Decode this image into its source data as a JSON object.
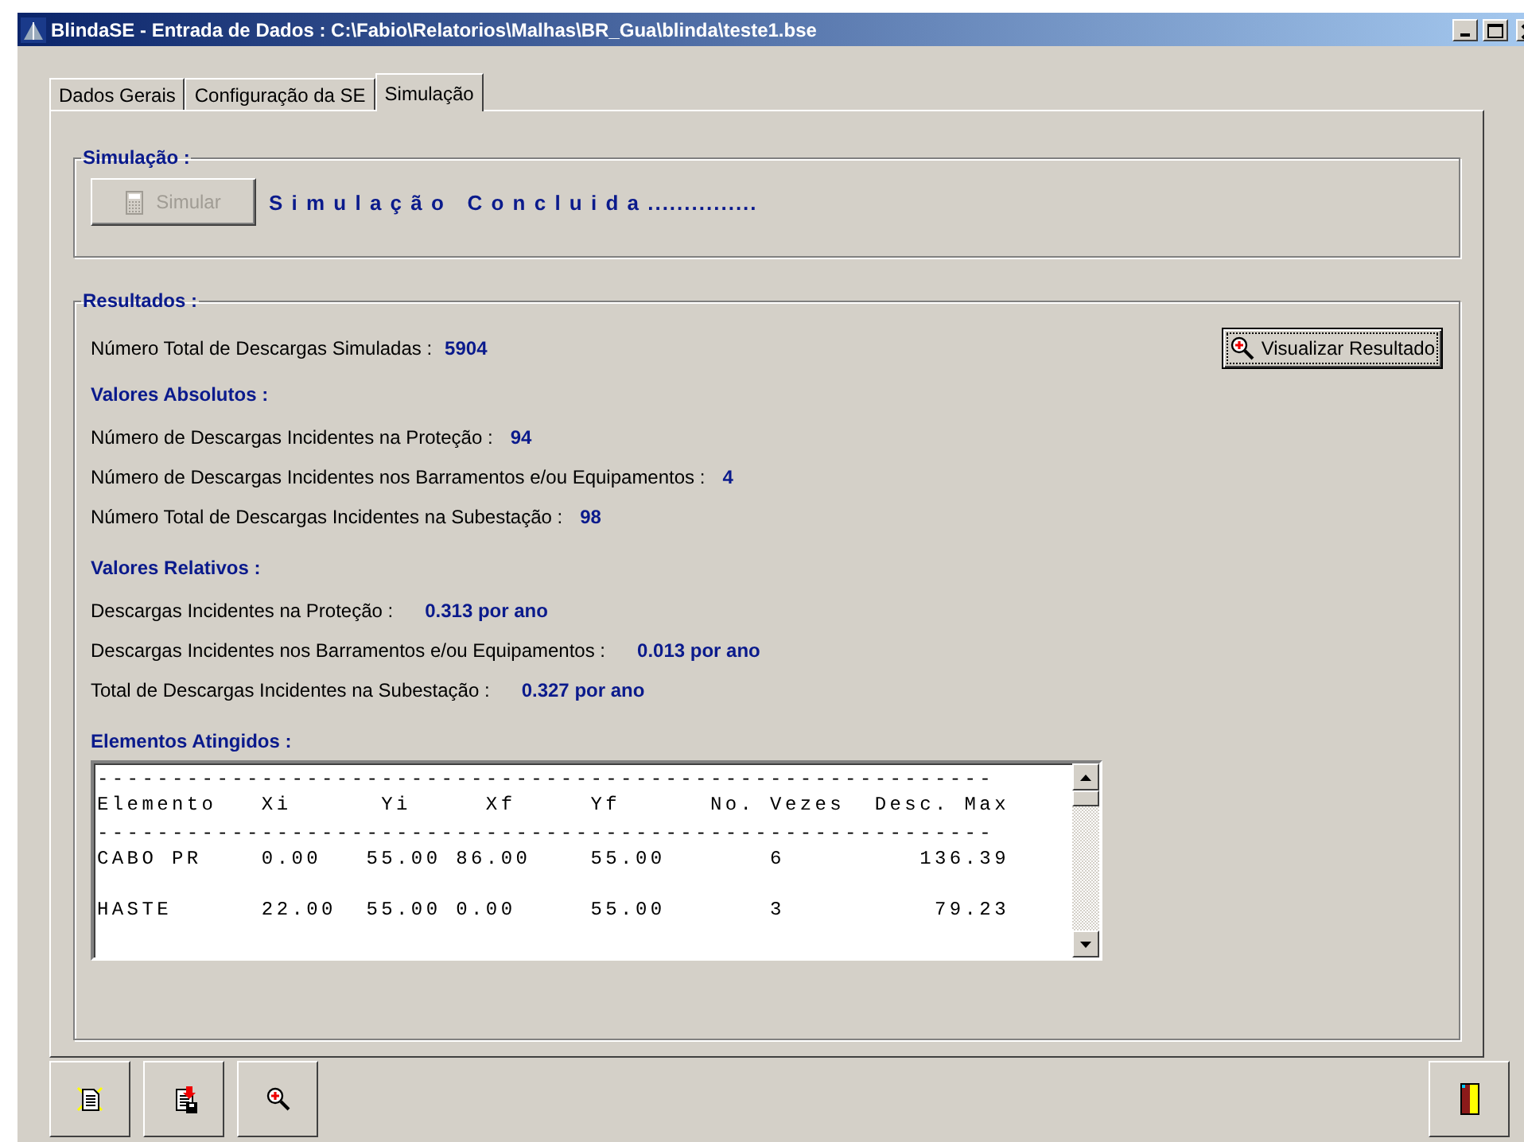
{
  "window": {
    "title": "BlindaSE - Entrada de Dados : C:\\Fabio\\Relatorios\\Malhas\\BR_Gua\\blinda\\teste1.bse"
  },
  "tabs": [
    {
      "label": "Dados Gerais",
      "selected": false
    },
    {
      "label": "Configuração da SE",
      "selected": false
    },
    {
      "label": "Simulação",
      "selected": true
    }
  ],
  "simulation": {
    "title": "Simulação :",
    "button": {
      "label": "Simular",
      "disabled": true
    },
    "status": "S i m u l a ç ã o   C o n c l u i d a ..............."
  },
  "results": {
    "title": "Resultados :",
    "total": {
      "label": "Número Total de Descargas Simuladas :",
      "value": "5904"
    },
    "view_button": {
      "label": "Visualizar Resultado"
    },
    "absolute": {
      "title": "Valores Absolutos :",
      "rows": [
        {
          "label": "Número de Descargas Incidentes na Proteção :",
          "value": "94"
        },
        {
          "label": "Número de Descargas Incidentes nos Barramentos e/ou Equipamentos :",
          "value": "4"
        },
        {
          "label": "Número Total de Descargas Incidentes na Subestação :",
          "value": "98"
        }
      ]
    },
    "relative": {
      "title": "Valores Relativos :",
      "rows": [
        {
          "label": "Descargas Incidentes na Proteção :",
          "value": "0.313 por ano"
        },
        {
          "label": "Descargas Incidentes nos Barramentos e/ou Equipamentos :",
          "value": "0.013 por ano"
        },
        {
          "label": "Total de Descargas Incidentes na Subestação :",
          "value": "0.327 por ano"
        }
      ]
    },
    "elements": {
      "title": "Elementos Atingidos :",
      "lines": [
        "------------------------------------------------------------",
        "Elemento   Xi      Yi     Xf     Yf      No. Vezes  Desc. Max",
        "------------------------------------------------------------",
        "CABO PR    0.00   55.00 86.00    55.00       6         136.39",
        "HASTE      22.00  55.00 0.00     55.00       3          79.23"
      ]
    }
  }
}
